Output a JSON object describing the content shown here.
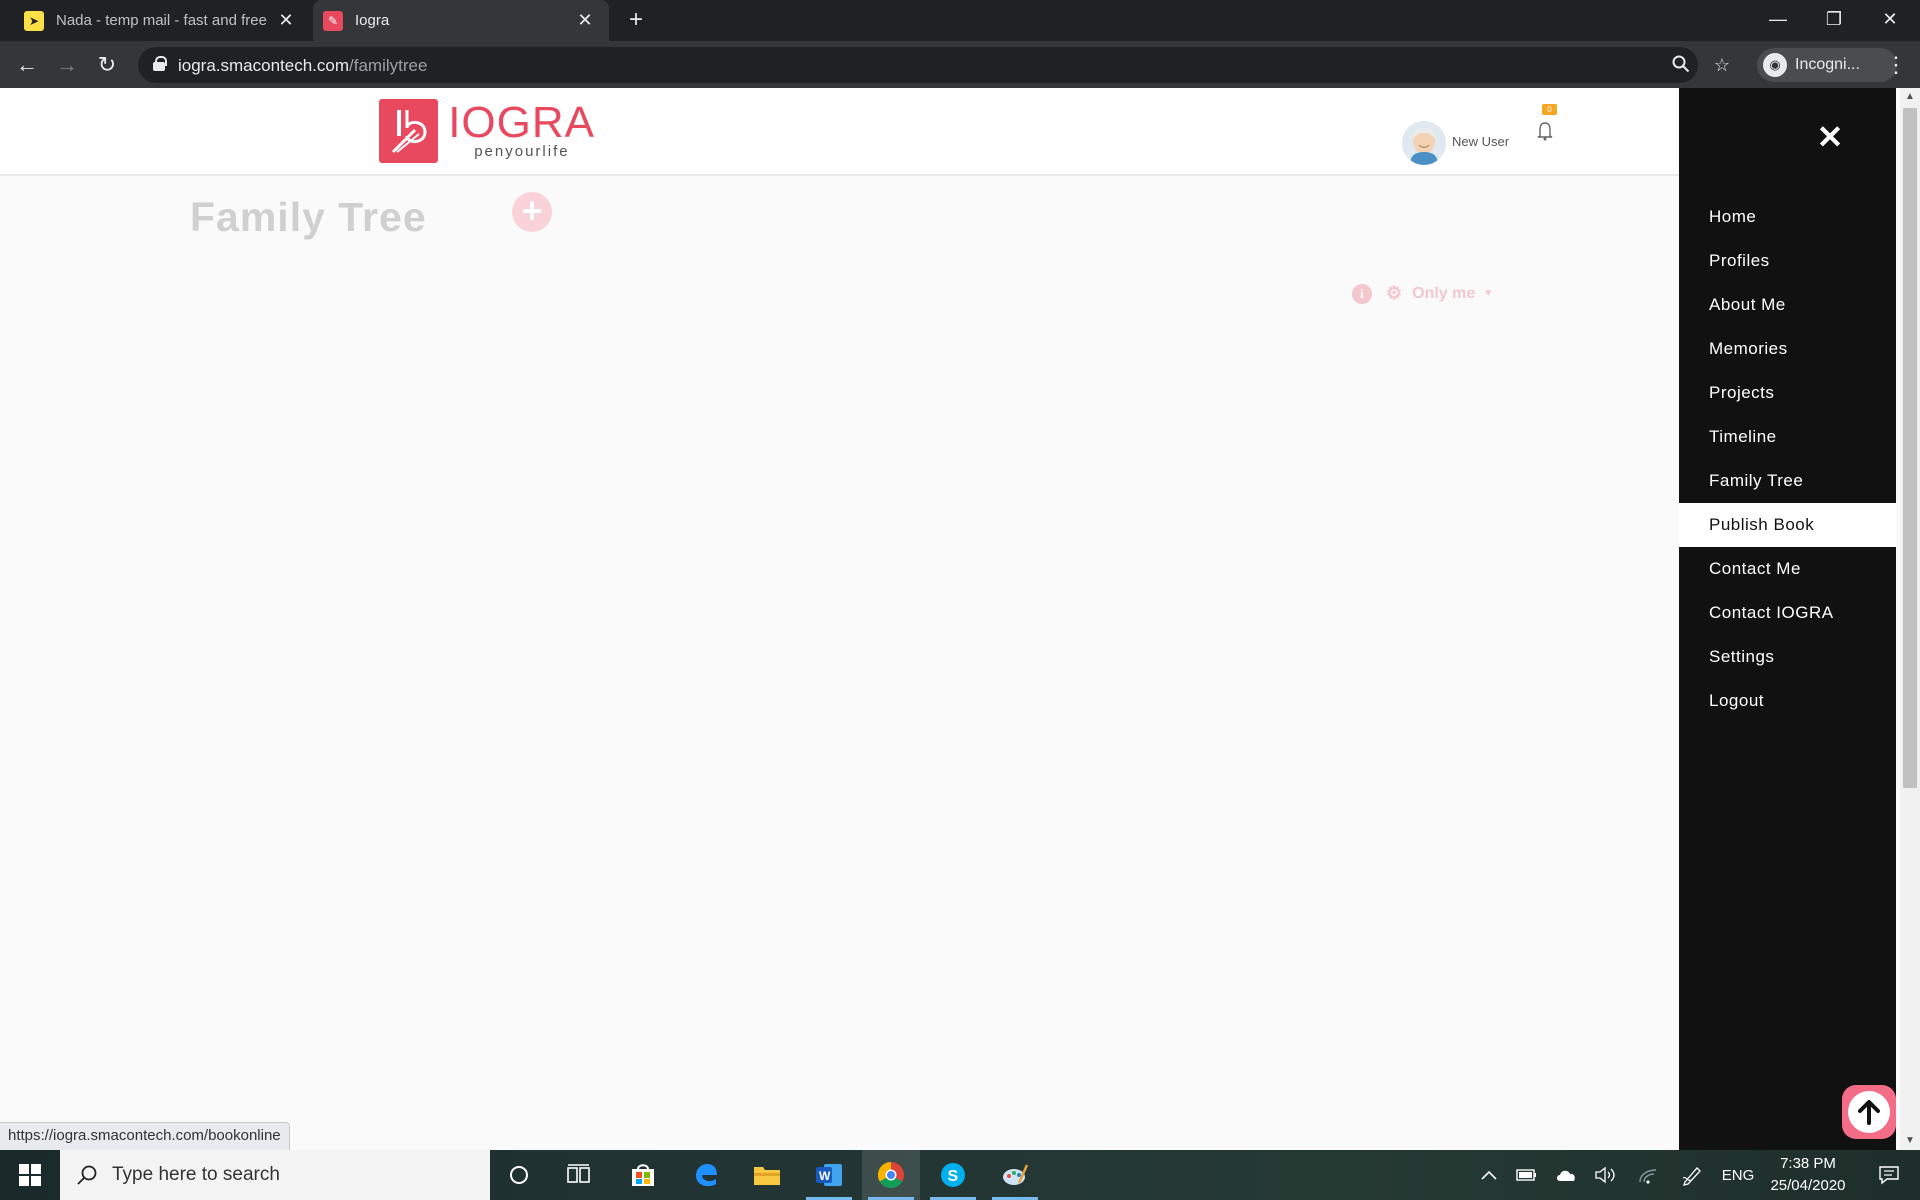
{
  "browser": {
    "tabs": [
      {
        "title": "Nada - temp mail - fast and free",
        "active": false
      },
      {
        "title": "Iogra",
        "active": true
      }
    ],
    "url_host": "iogra.smacontech.com",
    "url_path": "/familytree",
    "profile_label": "Incogni...",
    "status_url": "https://iogra.smacontech.com/bookonline"
  },
  "header": {
    "logo_name": "IOGRA",
    "logo_tagline": "penyourlife",
    "user_name": "New User",
    "notification_count": "0"
  },
  "main": {
    "page_title": "Family Tree",
    "privacy_label": "Only me"
  },
  "side_menu": {
    "items": [
      {
        "label": "Home"
      },
      {
        "label": "Profiles"
      },
      {
        "label": "About Me"
      },
      {
        "label": "Memories"
      },
      {
        "label": "Projects"
      },
      {
        "label": "Timeline"
      },
      {
        "label": "Family Tree"
      },
      {
        "label": "Publish Book",
        "active": true
      },
      {
        "label": "Contact Me"
      },
      {
        "label": "Contact IOGRA"
      },
      {
        "label": "Settings"
      },
      {
        "label": "Logout"
      }
    ]
  },
  "taskbar": {
    "search_placeholder": "Type here to search",
    "language": "ENG",
    "time": "7:38 PM",
    "date": "25/04/2020"
  },
  "colors": {
    "brand": "#e8495f",
    "menu_bg": "#111111",
    "chrome_dark": "#202124",
    "chrome_toolbar": "#35363a"
  }
}
